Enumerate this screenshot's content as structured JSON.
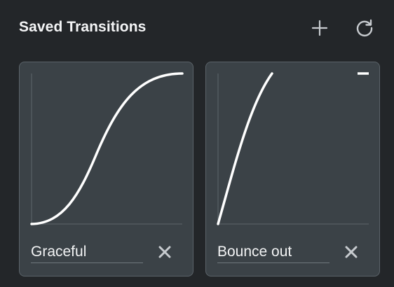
{
  "panel": {
    "title": "Saved Transitions",
    "add_icon": "plus-icon",
    "reset_icon": "refresh-icon"
  },
  "colors": {
    "background": "#232629",
    "card_background": "#3b4247",
    "card_border": "#5b6369",
    "curve": "#ffffff",
    "icon": "#c7cbcf",
    "text": "#f4f5f6"
  },
  "transitions": [
    {
      "name": "Graceful",
      "delete_icon": "close-icon"
    },
    {
      "name": "Bounce out",
      "delete_icon": "close-icon"
    }
  ]
}
